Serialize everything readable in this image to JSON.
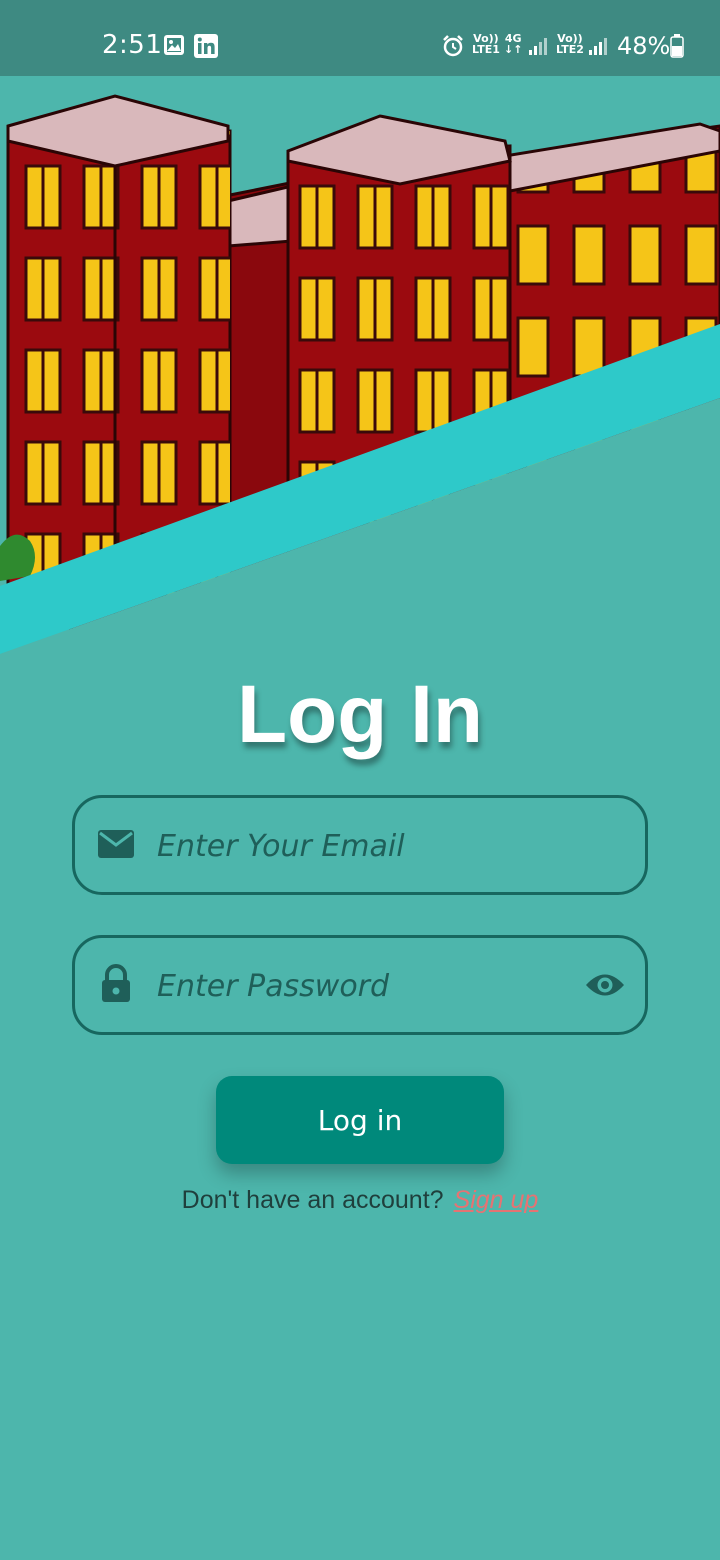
{
  "status_bar": {
    "time": "2:51",
    "net1_top": "Vo))",
    "net1_bottom": "LTE1",
    "net_4g_top": "4G",
    "net_4g_bottom": "↓↑",
    "net2_top": "Vo))",
    "net2_bottom": "LTE2",
    "battery": "48%",
    "icons": [
      "gallery-icon",
      "linkedin-icon",
      "alarm-icon",
      "signal-icon",
      "signal-icon",
      "battery-icon"
    ]
  },
  "hero": {
    "illustration": "red-brick-building-icon",
    "colors": {
      "brick": "#9b0a0f",
      "window": "#f5c518",
      "roof": "#d9b8bb",
      "stripe": "#2ec9c9"
    }
  },
  "login": {
    "title": "Log In",
    "email_placeholder": "Enter Your Email",
    "password_placeholder": "Enter Password",
    "button_label": "Log in",
    "signup_prompt": "Don't have an account?",
    "signup_link": "Sign up"
  },
  "colors": {
    "background": "#4db6ac",
    "status_bar": "#3e8a82",
    "field_border": "#17675f",
    "button": "#00897b",
    "link": "#e57373"
  }
}
